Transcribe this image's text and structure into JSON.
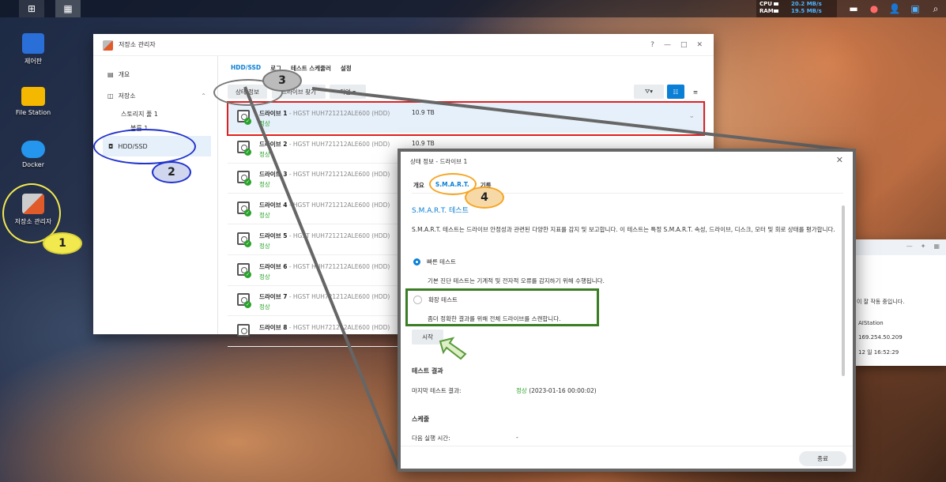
{
  "topbar": {
    "cpu_label": "CPU",
    "ram_label": "RAM",
    "upload": "20.2 MB/s",
    "download": "19.5 MB/s"
  },
  "desktop": {
    "icons": [
      {
        "label": "제어판"
      },
      {
        "label": "File Station"
      },
      {
        "label": "Docker"
      },
      {
        "label": "저장소 관리자"
      }
    ]
  },
  "storage_window": {
    "title": "저장소 관리자",
    "controls": {
      "help": "?",
      "minimize": "—",
      "maximize": "□",
      "close": "✕"
    },
    "sidebar": {
      "overview": "개요",
      "storage": "저장소",
      "pool": "스토리지 풀 1",
      "volume": "볼륨 1",
      "hdd": "HDD/SSD"
    },
    "tabs": [
      "HDD/SSD",
      "로그",
      "테스트 스케줄러",
      "설정"
    ],
    "toolbar": {
      "status_info": "상태 정보",
      "find_drive": "드라이브 찾기",
      "action": "작업 ▾"
    },
    "drives": [
      {
        "name": "드라이브 1",
        "model": " - HGST HUH721212ALE600 (HDD)",
        "size": "10.9 TB",
        "status": "정상"
      },
      {
        "name": "드라이브 2",
        "model": " - HGST HUH721212ALE600 (HDD)",
        "size": "10.9 TB",
        "status": "정상"
      },
      {
        "name": "드라이브 3",
        "model": " - HGST HUH721212ALE600 (HDD)",
        "size": "",
        "status": "정상"
      },
      {
        "name": "드라이브 4",
        "model": " - HGST HUH721212ALE600 (HDD)",
        "size": "",
        "status": "정상"
      },
      {
        "name": "드라이브 5",
        "model": " - HGST HUH721212ALE600 (HDD)",
        "size": "",
        "status": "정상"
      },
      {
        "name": "드라이브 6",
        "model": " - HGST HUH721212ALE600 (HDD)",
        "size": "",
        "status": "정상"
      },
      {
        "name": "드라이브 7",
        "model": " - HGST HUH721212ALE600 (HDD)",
        "size": "",
        "status": "정상"
      },
      {
        "name": "드라이브 8",
        "model": " - HGST HUH721212ALE600 (HDD)",
        "size": "",
        "status": ""
      }
    ]
  },
  "dialog": {
    "title": "상태 정보 - 드라이브 1",
    "tabs": [
      "개요",
      "S.M.A.R.T.",
      "기록"
    ],
    "section_title": "S.M.A.R.T. 테스트",
    "description": "S.M.A.R.T. 테스트는 드라이브 안정성과 관련된 다양한 지표를 감지 및 보고합니다. 이 테스트는 특정 S.M.A.R.T. 속성, 드라이브, 디스크, 모터 및 회로 상태를 평가합니다.",
    "quick_test": "빠른 테스트",
    "quick_desc": "기본 진단 테스트는 기계적 및 전자적 오류를 감지하기 위해 수행됩니다.",
    "extended_test": "확장 테스트",
    "extended_desc": "좀더 정확한 결과를 위해 전체 드라이브를 스캔합니다.",
    "start": "시작",
    "result_header": "테스트 결과",
    "last_result_label": "마지막 테스트 결과:",
    "last_result_status": "정상",
    "last_result_date": " (2023-01-16 00:00:02)",
    "schedule_header": "스케줄",
    "next_run_label": "다음 실행 시간:",
    "next_run_value": "-",
    "close": "종료"
  },
  "right_panel": {
    "line1": "이 잘 작동 중입니다.",
    "line2": "AIStation",
    "line3": "169.254.50.209",
    "line4": "12 일 16:52:29"
  },
  "badges": [
    "1",
    "2",
    "3",
    "4"
  ],
  "colors": {
    "accent": "#0a7fd6",
    "ok": "#29a329",
    "highlight_red": "#e02020",
    "badge_yellow": "#f2e94e",
    "badge_blue": "#2233cc",
    "badge_gray": "#777777",
    "badge_orange": "#f5a623",
    "badge_green": "#3a7d24"
  }
}
